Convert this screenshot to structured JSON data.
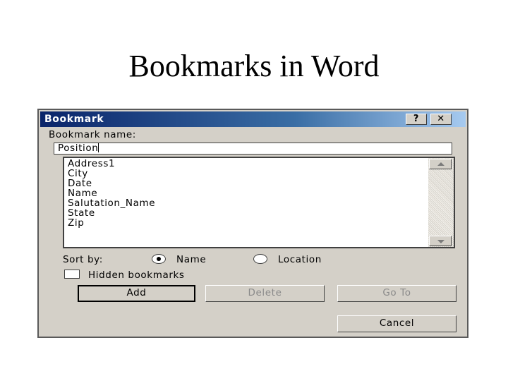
{
  "slide": {
    "title": "Bookmarks in Word"
  },
  "dialog": {
    "title": "Bookmark",
    "help_button": "?",
    "close_button": "✕",
    "bookmark_name_label": "Bookmark name:",
    "bookmark_name_value": "Position",
    "bookmarks": [
      "Address1",
      "City",
      "Date",
      "Name",
      "Salutation_Name",
      "State",
      "Zip"
    ],
    "sort_by_label": "Sort by:",
    "sort_options": {
      "name": "Name",
      "location": "Location",
      "selected": "Name"
    },
    "hidden_bookmarks_label": "Hidden bookmarks",
    "hidden_bookmarks_checked": false,
    "buttons": {
      "add": "Add",
      "delete": "Delete",
      "goto": "Go To",
      "cancel": "Cancel"
    }
  },
  "colors": {
    "dialog_bg": "#d4d0c8",
    "titlebar_start": "#0a246a",
    "titlebar_end": "#a6caf0"
  }
}
